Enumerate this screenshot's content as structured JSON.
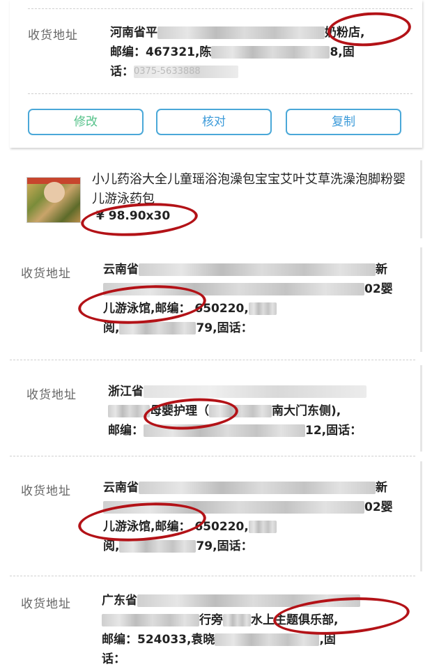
{
  "label": "收货地址",
  "buttons": {
    "edit": "修改",
    "check": "核对",
    "copy": "复制"
  },
  "entry1": {
    "line1_prefix": "河南省平",
    "line1_suffix": "奶粉店,",
    "line2_prefix": "邮编：467321,陈",
    "line2_suffix": "8,固",
    "line3_prefix": "话：",
    "line3_blur": "0375-5633888"
  },
  "product": {
    "title": "小儿药浴大全儿童瑶浴泡澡包宝宝艾叶艾草洗澡泡脚粉婴儿游泳药包",
    "price": "¥ 98.90x30"
  },
  "entry2": {
    "line1_prefix": "云南省",
    "line1_suffix": "新",
    "line2_suffix": "02婴",
    "line3_a": "儿游泳馆,邮编：",
    "line3_b": "650220,",
    "line4_prefix": "阅,",
    "line4_suffix": "79,固话："
  },
  "entry3": {
    "line1_prefix": "浙江省",
    "line2_mid": "母婴护理（",
    "line2_suffix": "南大门东侧),",
    "line3_prefix": "邮编：",
    "line3_suffix": "12,固话："
  },
  "entry4": {
    "line1_prefix": "云南省",
    "line1_suffix": "新",
    "line2_suffix": "02婴",
    "line3_a": "儿游泳馆,邮编：",
    "line3_b": "650220,",
    "line4_prefix": "阅,",
    "line4_suffix": "79,固话："
  },
  "entry5": {
    "line1_prefix": "广东省",
    "line2_mid": "行旁",
    "line2_suffix": "水上主题俱乐部,",
    "line3_prefix": "邮编：524033,袁晓",
    "line3_suffix": ",固",
    "line4": "话："
  }
}
